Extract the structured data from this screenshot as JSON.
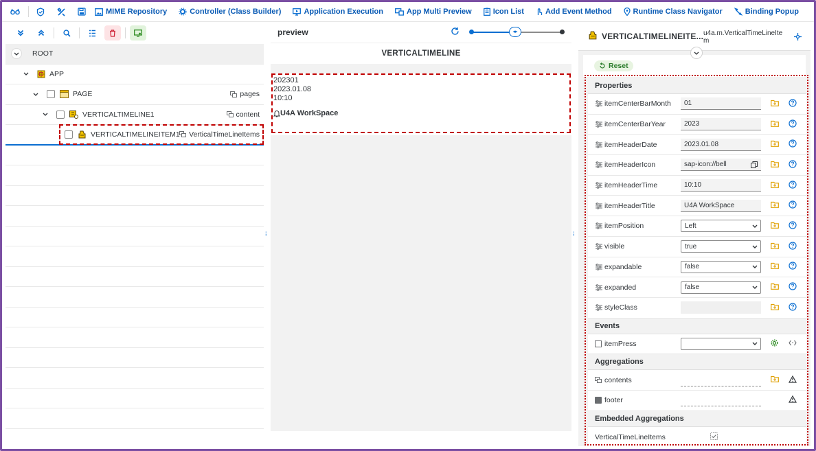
{
  "toolbar": {
    "items": [
      {
        "label": "MIME Repository",
        "icon": "image-icon"
      },
      {
        "label": "Controller (Class Builder)",
        "icon": "gears-icon"
      },
      {
        "label": "Application Execution",
        "icon": "monitor-run-icon"
      },
      {
        "label": "App Multi Preview",
        "icon": "multi-screen-icon"
      },
      {
        "label": "Icon List",
        "icon": "clipboard-icon"
      },
      {
        "label": "Add Event Method",
        "icon": "touch-icon"
      },
      {
        "label": "Runtime Class Navigator",
        "icon": "location-pin-icon"
      },
      {
        "label": "Binding Popup",
        "icon": "link-icon"
      }
    ]
  },
  "tree": {
    "root": "ROOT",
    "app": "APP",
    "page": {
      "label": "PAGE",
      "agg": "pages"
    },
    "timeline": {
      "label": "VERTICALTIMELINE1",
      "agg": "content"
    },
    "item": {
      "label": "VERTICALTIMELINEITEM1",
      "agg": "VerticalTimeLineItems"
    }
  },
  "preview": {
    "title": "preview",
    "control": "VERTICALTIMELINE",
    "lines": [
      "202301",
      "2023.01.08",
      "10:10"
    ],
    "item_title": "U4A WorkSpace"
  },
  "attr": {
    "title": "VERTICALTIMELINEITE...",
    "class_line1": "u4a.m.VerticalTimeLineIte",
    "class_line2": "m",
    "reset_label": "Reset",
    "sections": {
      "properties": "Properties",
      "events": "Events",
      "aggregations": "Aggregations",
      "embedded": "Embedded Aggregations"
    },
    "properties": [
      {
        "name": "itemCenterBarMonth",
        "value": "01",
        "type": "input"
      },
      {
        "name": "itemCenterBarYear",
        "value": "2023",
        "type": "input"
      },
      {
        "name": "itemHeaderDate",
        "value": "2023.01.08",
        "type": "input"
      },
      {
        "name": "itemHeaderIcon",
        "value": "sap-icon://bell",
        "type": "icon-input"
      },
      {
        "name": "itemHeaderTime",
        "value": "10:10",
        "type": "input"
      },
      {
        "name": "itemHeaderTitle",
        "value": "U4A WorkSpace",
        "type": "input"
      },
      {
        "name": "itemPosition",
        "value": "Left",
        "type": "select"
      },
      {
        "name": "visible",
        "value": "true",
        "type": "select"
      },
      {
        "name": "expandable",
        "value": "false",
        "type": "select"
      },
      {
        "name": "expanded",
        "value": "false",
        "type": "select"
      },
      {
        "name": "styleClass",
        "value": "",
        "type": "plain"
      }
    ],
    "events": [
      {
        "name": "itemPress",
        "value": ""
      }
    ],
    "aggregations": [
      {
        "name": "contents"
      },
      {
        "name": "footer"
      }
    ],
    "embedded": [
      {
        "name": "VerticalTimeLineItems"
      }
    ]
  },
  "colors": {
    "accent": "#0a6ed1",
    "frame": "#7b4fa3",
    "highlight": "#c00000"
  }
}
